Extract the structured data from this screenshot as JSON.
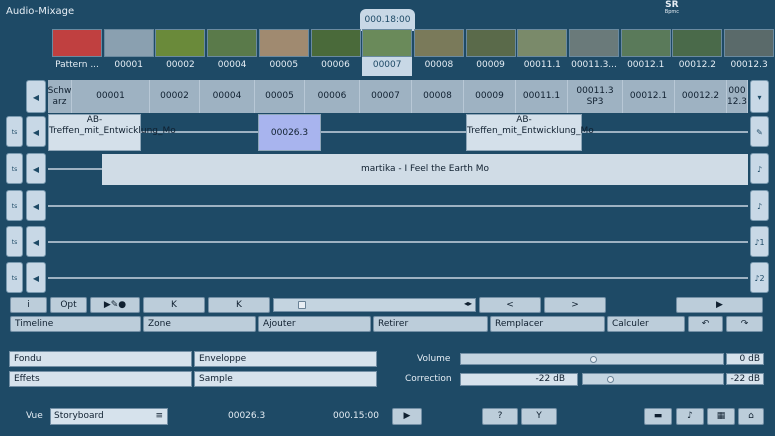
{
  "app": {
    "title": "Audio-Mixage",
    "badge": "SR",
    "badge_sub": "Bpmc",
    "current_time": "000.18:00"
  },
  "thumbs": [
    {
      "label": "Pattern ...",
      "color": "#c04040"
    },
    {
      "label": "00001",
      "color": "#8aa0b0"
    },
    {
      "label": "00002",
      "color": "#6a8a3a"
    },
    {
      "label": "00004",
      "color": "#5a7a4a"
    },
    {
      "label": "00005",
      "color": "#a08a70"
    },
    {
      "label": "00006",
      "color": "#4a6a3a"
    },
    {
      "label": "00007",
      "color": "#6a8a5a"
    },
    {
      "label": "00008",
      "color": "#7a7a5a"
    },
    {
      "label": "00009",
      "color": "#5a6a4a"
    },
    {
      "label": "00011.1",
      "color": "#7a8a6a"
    },
    {
      "label": "00011.3...",
      "color": "#6a7a7a"
    },
    {
      "label": "00012.1",
      "color": "#5a7a5a"
    },
    {
      "label": "00012.2",
      "color": "#4a6a4a"
    },
    {
      "label": "00012.3",
      "color": "#5a6a6a"
    }
  ],
  "story": [
    "Schw arz",
    "00001",
    "00002",
    "00004",
    "00005",
    "00006",
    "00007",
    "00008",
    "00009",
    "00011.1",
    "00011.3 SP3",
    "00012.1",
    "00012.2",
    "000 12.3"
  ],
  "tracks": {
    "clip1": "AB-Treffen_mit_Entwicklung_Mo",
    "clip2": "00026.3",
    "clip3": "AB-Treffen_mit_Entwicklung_Mo",
    "music": "martika - I Feel the Earth Mo"
  },
  "side_labels": {
    "track_left": "ts",
    "track_right": [
      "♪",
      "♪1",
      "♪2"
    ]
  },
  "toolbar": {
    "info": "i",
    "opt": "Opt",
    "play_rec": "▶✎●",
    "prev": "K",
    "next": "K",
    "arrows": "◂▸",
    "left": "<",
    "right": ">",
    "play": "▶"
  },
  "actions": {
    "timeline": "Timeline",
    "zone": "Zone",
    "ajouter": "Ajouter",
    "retirer": "Retirer",
    "remplacer": "Remplacer",
    "calculer": "Calculer",
    "undo": "↶",
    "redo": "↷"
  },
  "fx": {
    "fondu": "Fondu",
    "effets": "Effets",
    "enveloppe": "Enveloppe",
    "sample": "Sample"
  },
  "volume": {
    "label": "Volume",
    "value": "0 dB",
    "level": 0.5
  },
  "correction": {
    "label": "Correction",
    "left_value": "-22 dB",
    "right_value": "-22 dB",
    "level": 0.1
  },
  "footer": {
    "vue_label": "Vue",
    "vue_value": "Storyboard",
    "clip_name": "00026.3",
    "clip_time": "000.15:00",
    "play": "▶",
    "help": "?",
    "tool": "Y",
    "home": "⌂"
  }
}
